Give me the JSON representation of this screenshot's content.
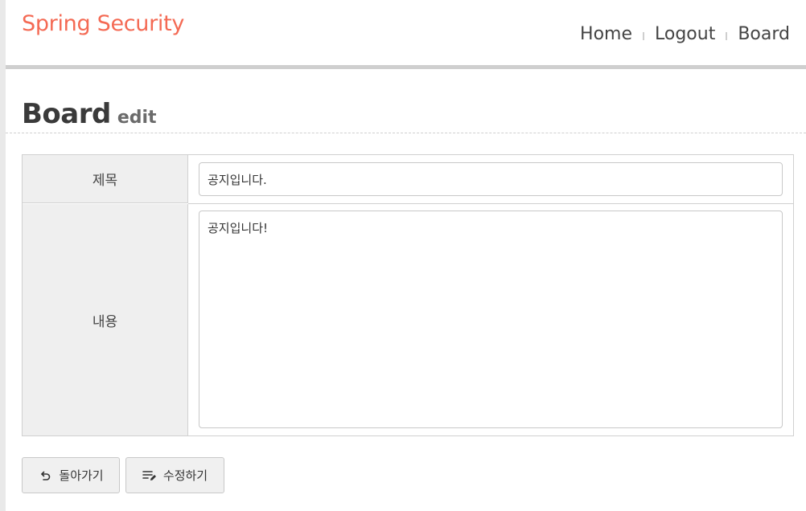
{
  "header": {
    "brand": "Spring Security",
    "nav": [
      {
        "label": "Home"
      },
      {
        "label": "Logout"
      },
      {
        "label": "Board"
      }
    ]
  },
  "page": {
    "title": "Board",
    "subtitle": "edit"
  },
  "form": {
    "title_label": "제목",
    "title_value": "공지입니다.",
    "content_label": "내용",
    "content_value": "공지입니다!"
  },
  "actions": {
    "back_label": "돌아가기",
    "back_icon": "undo-icon",
    "edit_label": "수정하기",
    "edit_icon": "edit-list-icon"
  }
}
